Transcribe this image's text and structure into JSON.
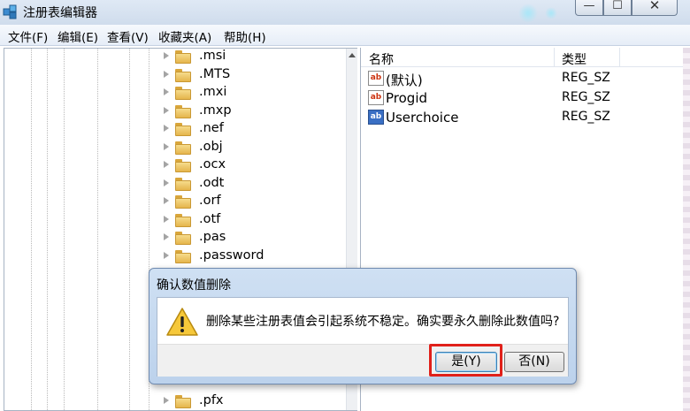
{
  "window": {
    "title": "注册表编辑器"
  },
  "menu": [
    "文件(F)",
    "编辑(E)",
    "查看(V)",
    "收藏夹(A)",
    "帮助(H)"
  ],
  "tree": {
    "items": [
      ".msi",
      ".MTS",
      ".mxi",
      ".mxp",
      ".nef",
      ".obj",
      ".ocx",
      ".odt",
      ".orf",
      ".otf",
      ".pas",
      ".password",
      ".pfx"
    ]
  },
  "list": {
    "headers": {
      "name": "名称",
      "type": "类型"
    },
    "rows": [
      {
        "name": "(默认)",
        "type": "REG_SZ",
        "icon": "string-value-icon"
      },
      {
        "name": "Progid",
        "type": "REG_SZ",
        "icon": "string-value-icon"
      },
      {
        "name": "Userchoice",
        "type": "REG_SZ",
        "icon": "binary-value-icon"
      }
    ]
  },
  "dialog": {
    "title": "确认数值删除",
    "message": "删除某些注册表值会引起系统不稳定。确实要永久删除此数值吗?",
    "yes_label": "是(Y)",
    "no_label": "否(N)",
    "icon": "warning-icon"
  },
  "colors": {
    "highlight": "#e0201a",
    "dialog_frame": "#bcd2ec"
  }
}
